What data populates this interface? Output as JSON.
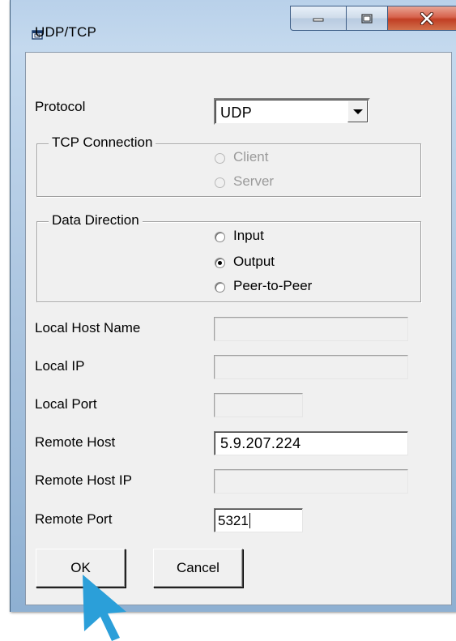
{
  "window": {
    "title": "UDP/TCP",
    "icon": "window-icon",
    "controls": {
      "minimize": "minimize-icon",
      "maximize": "maximize-icon",
      "close": "close-icon"
    }
  },
  "protocol": {
    "label": "Protocol",
    "value": "UDP"
  },
  "tcp_connection": {
    "legend": "TCP Connection",
    "options": [
      "Client",
      "Server"
    ],
    "enabled": false
  },
  "data_direction": {
    "legend": "Data Direction",
    "options": [
      "Input",
      "Output",
      "Peer-to-Peer"
    ],
    "selected": "Output"
  },
  "fields": {
    "local_host_name": {
      "label": "Local Host Name",
      "value": ""
    },
    "local_ip": {
      "label": "Local IP",
      "value": ""
    },
    "local_port": {
      "label": "Local Port",
      "value": ""
    },
    "remote_host": {
      "label": "Remote Host",
      "value": "5.9.207.224"
    },
    "remote_host_ip": {
      "label": "Remote Host IP",
      "value": ""
    },
    "remote_port": {
      "label": "Remote Port",
      "value": "5321"
    }
  },
  "buttons": {
    "ok": "OK",
    "cancel": "Cancel"
  },
  "colors": {
    "cursor": "#2b9fd9",
    "close_button": "#c94a2f",
    "frame": "#aac4df"
  }
}
